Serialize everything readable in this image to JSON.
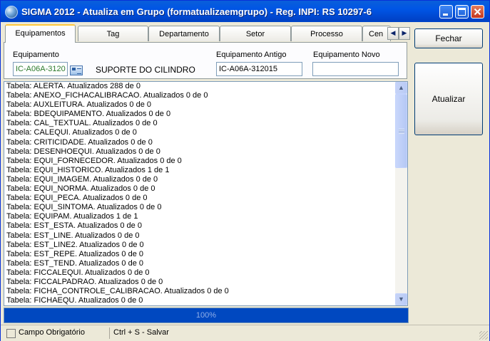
{
  "window": {
    "title": "SIGMA 2012 - Atualiza em Grupo  (formatualizaemgrupo)  - Reg. INPI: RS 10297-6",
    "controls": [
      "minimize-icon",
      "maximize-icon",
      "close-icon"
    ]
  },
  "tabs": [
    "Equipamentos",
    "Tag",
    "Departamento",
    "Setor",
    "Processo",
    "Cen"
  ],
  "form": {
    "equipamento_label": "Equipamento",
    "equipamento_value": "IC-A06A-3120",
    "equipamento_desc": "SUPORTE DO CILINDRO",
    "equip_antigo_label": "Equipamento Antigo",
    "equip_antigo_value": "IC-A06A-312015",
    "equip_novo_label": "Equipamento Novo",
    "equip_novo_value": ""
  },
  "log": [
    "Tabela: ALERTA. Atualizados 288 de 0",
    "Tabela: ANEXO_FICHACALIBRACAO. Atualizados 0 de 0",
    "Tabela: AUXLEITURA. Atualizados 0 de 0",
    "Tabela: BDEQUIPAMENTO. Atualizados 0 de 0",
    "Tabela: CAL_TEXTUAL. Atualizados 0 de 0",
    "Tabela: CALEQUI. Atualizados 0 de 0",
    "Tabela: CRITICIDADE. Atualizados 0 de 0",
    "Tabela: DESENHOEQUI. Atualizados 0 de 0",
    "Tabela: EQUI_FORNECEDOR. Atualizados 0 de 0",
    "Tabela: EQUI_HISTORICO. Atualizados 1 de 1",
    "Tabela: EQUI_IMAGEM. Atualizados 0 de 0",
    "Tabela: EQUI_NORMA. Atualizados 0 de 0",
    "Tabela: EQUI_PECA. Atualizados 0 de 0",
    "Tabela: EQUI_SINTOMA. Atualizados 0 de 0",
    "Tabela: EQUIPAM. Atualizados 1 de 1",
    "Tabela: EST_ESTA. Atualizados 0 de 0",
    "Tabela: EST_LINE. Atualizados 0 de 0",
    "Tabela: EST_LINE2. Atualizados 0 de 0",
    "Tabela: EST_REPE. Atualizados 0 de 0",
    "Tabela: EST_TEND. Atualizados 0 de 0",
    "Tabela: FICCALEQUI. Atualizados 0 de 0",
    "Tabela: FICCALPADRAO. Atualizados 0 de 0",
    "Tabela: FICHA_CONTROLE_CALIBRACAO. Atualizados 0 de 0",
    "Tabela: FICHAEQU. Atualizados 0 de 0"
  ],
  "progress": {
    "percent": 100,
    "label": "100%"
  },
  "buttons": {
    "fechar": "Fechar",
    "atualizar": "Atualizar"
  },
  "status": {
    "required_label": "Campo Obrigatório",
    "shortcut": "Ctrl + S - Salvar"
  },
  "colors": {
    "title_bar": "#0055e5",
    "progress_bar": "#003ea6",
    "required_text": "#2c7a2c"
  }
}
